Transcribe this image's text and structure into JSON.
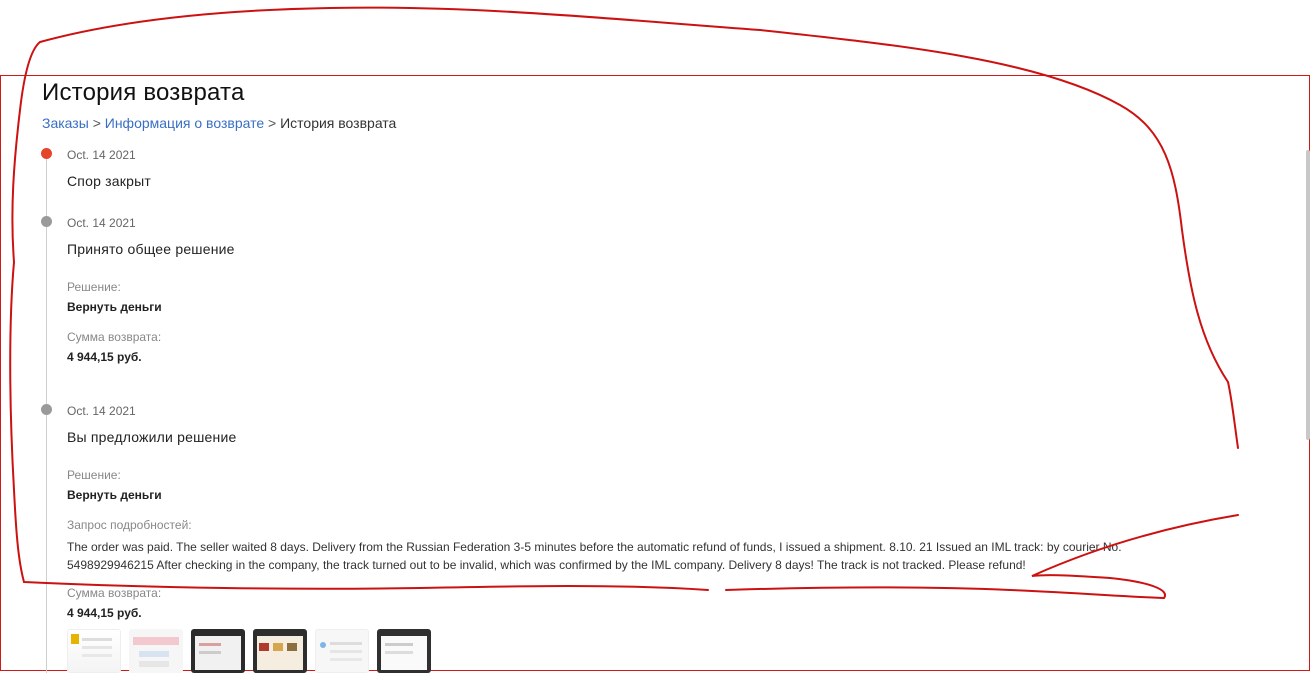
{
  "page": {
    "title": "История возврата",
    "accent_color": "#e5462a",
    "link_color": "#3a6fc4"
  },
  "breadcrumb": {
    "items": [
      {
        "label": "Заказы"
      },
      {
        "label": "Информация о возврате"
      },
      {
        "label": "История возврата"
      }
    ],
    "separator": ">"
  },
  "timeline": [
    {
      "date": "Oct. 14 2021",
      "title": "Спор закрыт",
      "status": "active"
    },
    {
      "date": "Oct. 14 2021",
      "title": "Принято общее решение",
      "decision_label": "Решение:",
      "decision_value": "Вернуть деньги",
      "amount_label": "Сумма возврата:",
      "amount_value": "4 944,15 руб."
    },
    {
      "date": "Oct. 14 2021",
      "title": "Вы предложили решение",
      "decision_label": "Решение:",
      "decision_value": "Вернуть деньги",
      "details_label": "Запрос подробностей:",
      "details_text": "The order was paid. The seller waited 8 days. Delivery from the Russian Federation 3-5 minutes before the automatic refund of funds, I issued a shipment. 8.10. 21 Issued an IML track: by courier No. 5498929946215 After checking in the company, the track turned out to be invalid, which was confirmed by the IML company. Delivery 8 days! The track is not tracked. Please refund!",
      "amount_label": "Сумма возврата:",
      "amount_value": "4 944,15 руб.",
      "attachments": [
        "attachment-1",
        "attachment-2",
        "attachment-3",
        "attachment-4",
        "attachment-5",
        "attachment-6"
      ]
    }
  ],
  "annotation_color": "#cc1111"
}
